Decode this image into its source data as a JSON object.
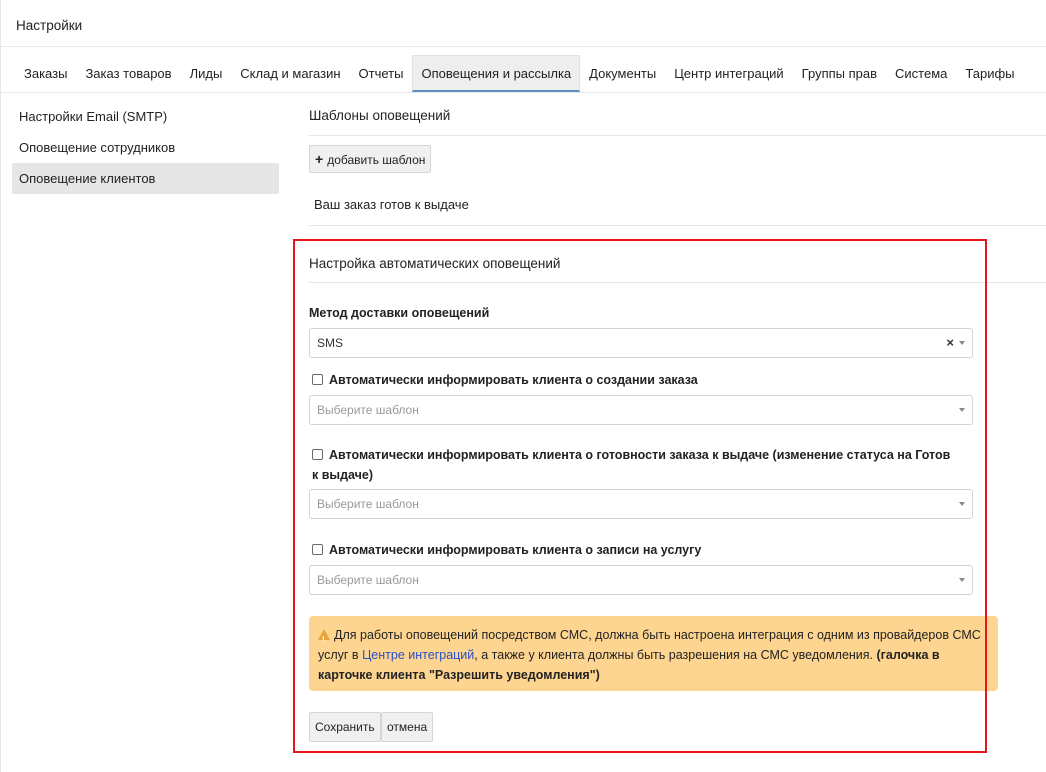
{
  "page": {
    "title": "Настройки"
  },
  "tabs": [
    {
      "label": "Заказы"
    },
    {
      "label": "Заказ товаров"
    },
    {
      "label": "Лиды"
    },
    {
      "label": "Склад и магазин"
    },
    {
      "label": "Отчеты"
    },
    {
      "label": "Оповещения и рассылка",
      "active": true
    },
    {
      "label": "Документы"
    },
    {
      "label": "Центр интеграций"
    },
    {
      "label": "Группы прав"
    },
    {
      "label": "Система"
    },
    {
      "label": "Тарифы"
    }
  ],
  "sidebar": {
    "items": [
      {
        "label": "Настройки Email (SMTP)"
      },
      {
        "label": "Оповещение сотрудников"
      },
      {
        "label": "Оповещение клиентов",
        "active": true
      }
    ]
  },
  "templates": {
    "title": "Шаблоны оповещений",
    "add_button": "добавить шаблон",
    "items": [
      "Ваш заказ готов к выдаче"
    ]
  },
  "auto": {
    "title": "Настройка автоматических оповещений",
    "method_label": "Метод доставки оповещений",
    "method_value": "SMS",
    "clear_symbol": "×",
    "checkboxes": [
      {
        "label": "Автоматически информировать клиента о создании заказа",
        "checked": false,
        "placeholder": "Выберите шаблон"
      },
      {
        "label": "Автоматически информировать клиента о готовности заказа к выдаче (изменение статуса на Готов к выдаче)",
        "checked": false,
        "placeholder": "Выберите шаблон"
      },
      {
        "label": "Автоматически информировать клиента о записи на услугу",
        "checked": false,
        "placeholder": "Выберите шаблон"
      }
    ],
    "warning": {
      "text_before": "Для работы оповещений посредством СМС, должна быть настроена интеграция с одним из провайдеров СМС услуг в ",
      "link": "Центре интеграций",
      "text_after": ", а также у клиента должны быть разрешения на СМС уведомления. ",
      "bold": "(галочка в карточке клиента \"Разрешить уведомления\")",
      "icon_color": "#e8a23a",
      "bg_color": "#fdd590"
    },
    "save_button": "Сохранить",
    "cancel_button": "отмена"
  },
  "highlight": {
    "color": "#e8141d"
  }
}
